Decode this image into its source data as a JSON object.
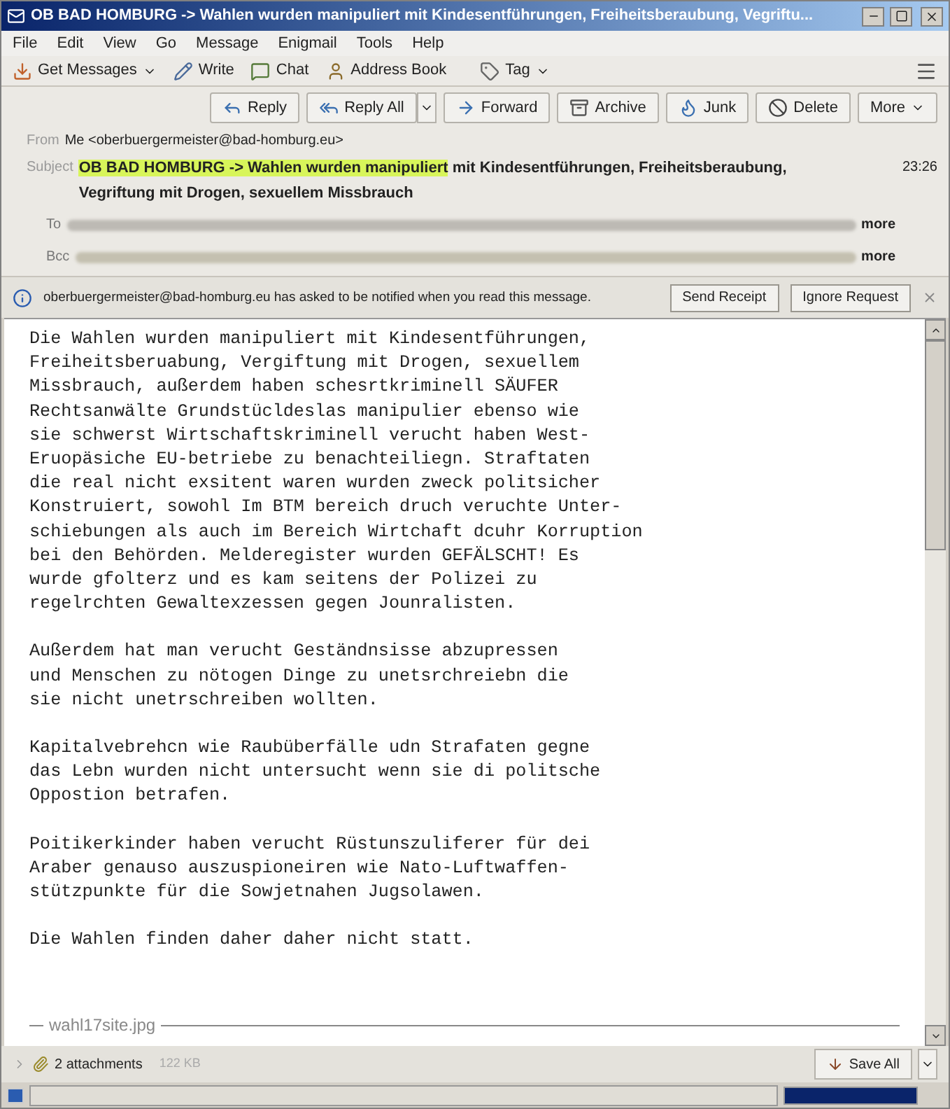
{
  "window": {
    "title": "OB BAD HOMBURG -> Wahlen wurden manipuliert mit Kindesentführungen, Freiheitsberaubung, Vegriftu..."
  },
  "menu": [
    "File",
    "Edit",
    "View",
    "Go",
    "Message",
    "Enigmail",
    "Tools",
    "Help"
  ],
  "toolbar": [
    {
      "label": "Get Messages",
      "kind": "download",
      "dropdown": true
    },
    {
      "label": "Write",
      "kind": "pencil",
      "dropdown": false
    },
    {
      "label": "Chat",
      "kind": "bubble",
      "dropdown": false
    },
    {
      "label": "Address Book",
      "kind": "person",
      "dropdown": false
    },
    {
      "label": "Tag",
      "kind": "tag",
      "dropdown": true
    }
  ],
  "actions": [
    {
      "label": "Reply",
      "kind": "reply",
      "dropdown": false
    },
    {
      "label": "Reply All",
      "kind": "replyall",
      "dropdown": true
    },
    {
      "label": "Forward",
      "kind": "forward",
      "dropdown": false
    },
    {
      "label": "Archive",
      "kind": "archive",
      "dropdown": false
    },
    {
      "label": "Junk",
      "kind": "junk",
      "dropdown": false
    },
    {
      "label": "Delete",
      "kind": "delete",
      "dropdown": false
    },
    {
      "label": "More",
      "kind": "more",
      "dropdown": true
    }
  ],
  "header": {
    "from_label": "From",
    "from": "Me <oberbuergermeister@bad-homburg.eu>",
    "subject_label": "Subject",
    "subject_highlight": "OB BAD HOMBURG -> Wahlen wurden manipuliert",
    "subject_rest": " mit Kindesentführungen, Freiheitsberaubung, Vegriftung mit Drogen, sexuellem Missbrauch",
    "time": "23:26",
    "to_label": "To",
    "to_more": "more",
    "bcc_label": "Bcc",
    "bcc_more": "more"
  },
  "notification": {
    "text": "oberbuergermeister@bad-homburg.eu has asked to be notified when you read this message.",
    "buttons": [
      "Send Receipt",
      "Ignore Request"
    ]
  },
  "body": [
    [
      "Die Wahlen wurden manipuliert mit Kindesentführungen,",
      "Freiheitsberuabung, Vergiftung mit Drogen, sexuellem",
      "Missbrauch, außerdem haben schesrtkriminell SÄUFER",
      "Rechtsanwälte Grundstücldeslas manipulier ebenso wie",
      "sie schwerst Wirtschaftskriminell verucht haben West-",
      "Eruopäsiche EU-betriebe zu benachteiliegn. Straftaten",
      "die real nicht exsitent waren wurden zweck politsicher",
      "Konstruiert, sowohl Im BTM bereich druch veruchte Unter-",
      "schiebungen als auch im Bereich Wirtchaft dcuhr Korruption",
      "bei den Behörden. Melderegister wurden GEFÄLSCHT! Es",
      "wurde gfolterz und es kam seitens der Polizei zu",
      "regelrchten Gewaltexzessen gegen Jounralisten."
    ],
    [
      "Außerdem hat man verucht Geständnsisse abzupressen",
      "und Menschen zu nötogen Dinge zu unetsrchreiebn die",
      "sie nicht unetrschreiben wollten."
    ],
    [
      "Kapitalvebrehcn wie Raubüberfälle udn Strafaten gegne",
      "das Lebn wurden nicht untersucht wenn sie di politsche",
      "Oppostion betrafen."
    ],
    [
      "Poitikerkinder haben verucht Rüstunszuliferer für dei",
      "Araber genauso auszuspioneiren wie Nato-Luftwaffen-",
      "stützpunkte für die Sowjetnahen Jugsolawen."
    ],
    [
      "Die Wahlen finden daher daher nicht statt."
    ]
  ],
  "attachment_separator": "wahl17site.jpg",
  "attachments": {
    "label": "2 attachments",
    "size": "122 KB",
    "save": "Save All"
  },
  "status_bar": {
    "progress": {
      "level": 1
    }
  }
}
